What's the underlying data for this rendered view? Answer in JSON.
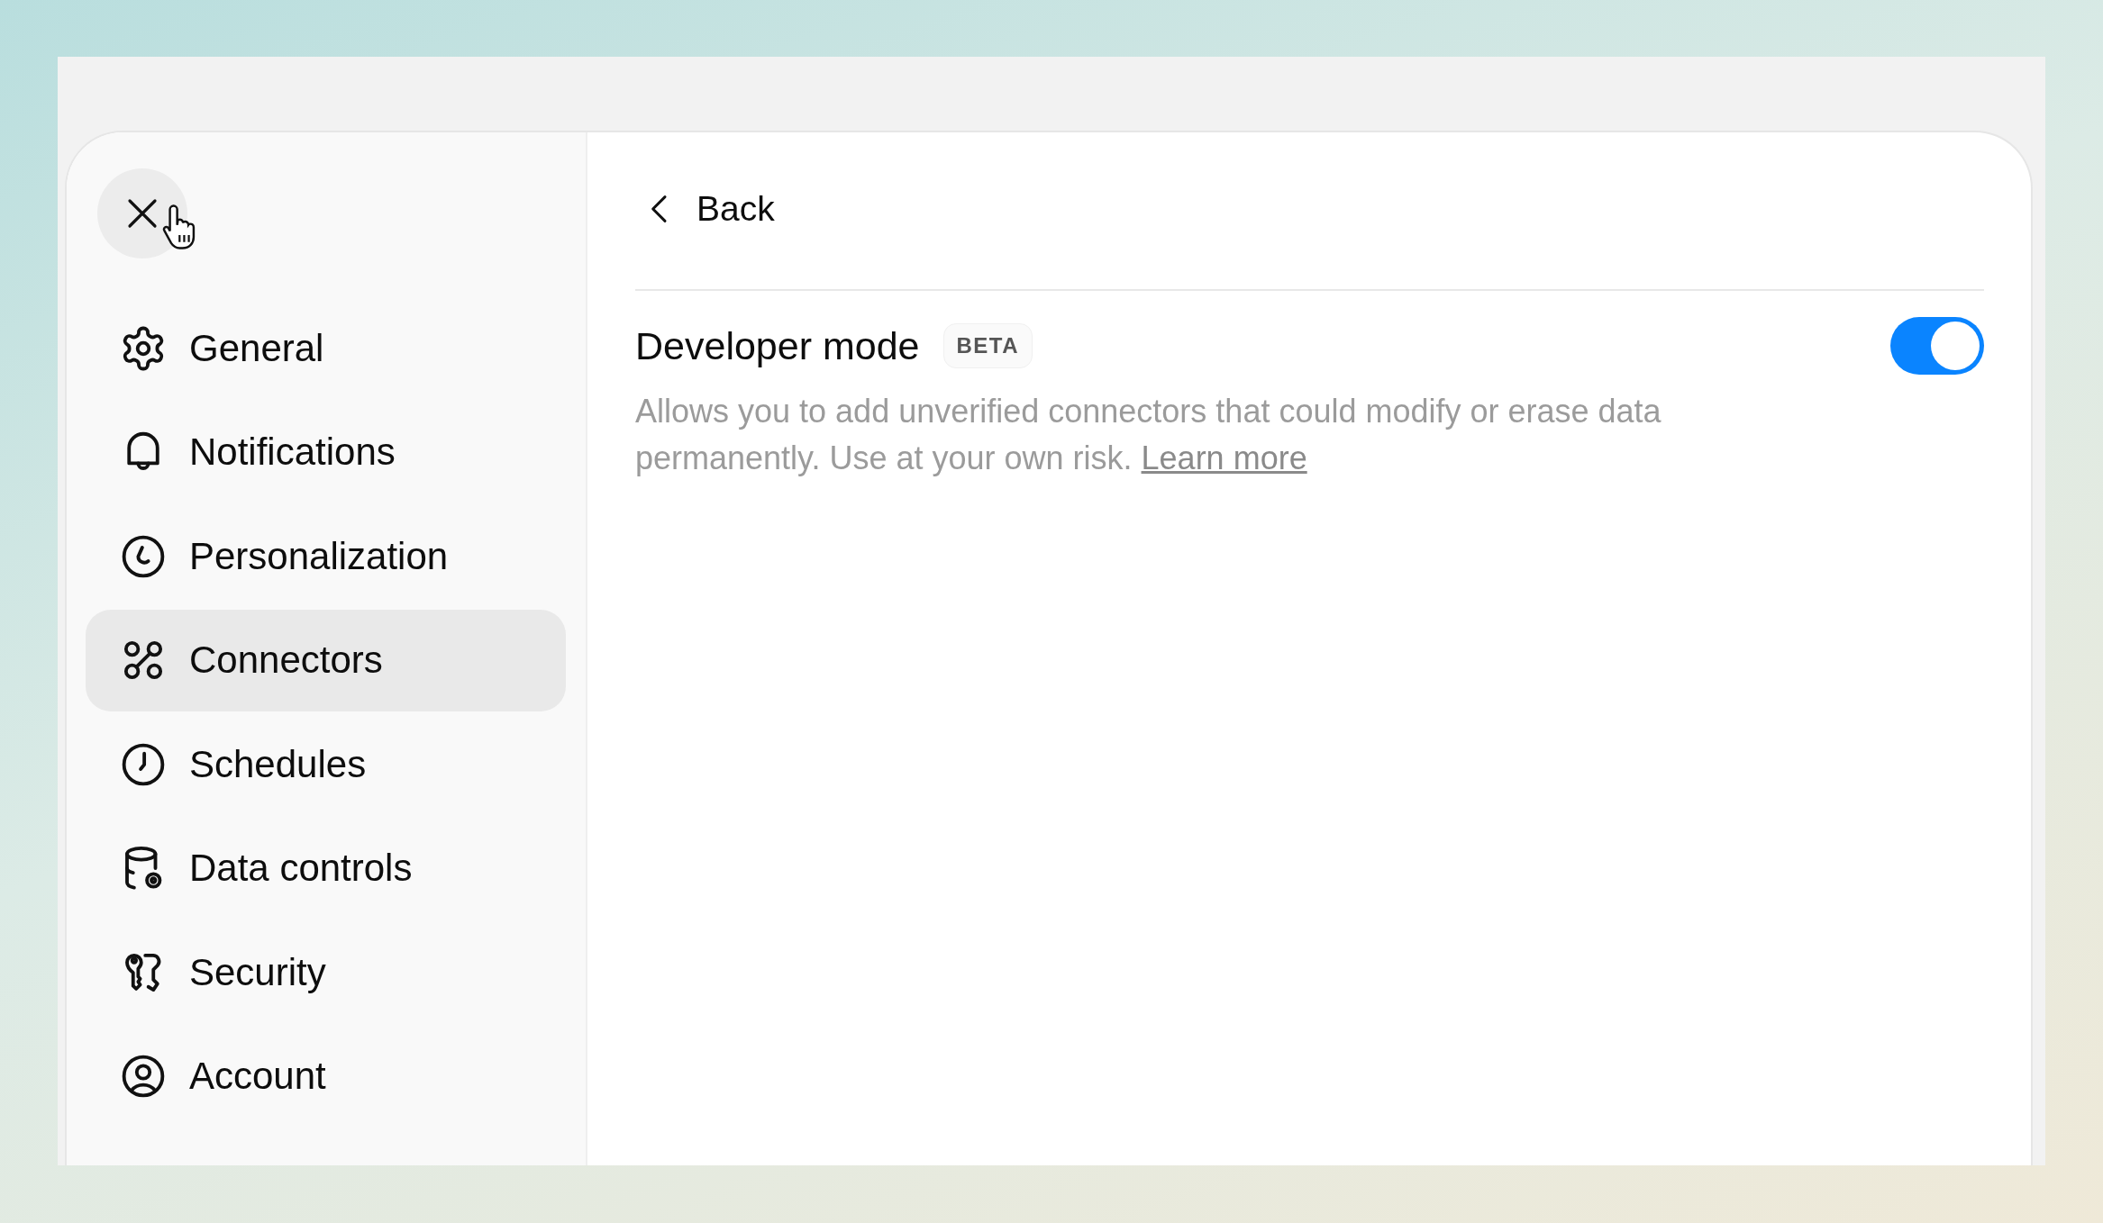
{
  "sidebar": {
    "items": [
      {
        "label": "General",
        "selected": false
      },
      {
        "label": "Notifications",
        "selected": false
      },
      {
        "label": "Personalization",
        "selected": false
      },
      {
        "label": "Connectors",
        "selected": true
      },
      {
        "label": "Schedules",
        "selected": false
      },
      {
        "label": "Data controls",
        "selected": false
      },
      {
        "label": "Security",
        "selected": false
      },
      {
        "label": "Account",
        "selected": false
      }
    ]
  },
  "header": {
    "back": "Back"
  },
  "setting": {
    "title": "Developer mode",
    "badge": "BETA",
    "on": true,
    "description": "Allows you to add unverified connectors that could modify or erase data permanently. Use at your own risk.",
    "link": "Learn more"
  }
}
